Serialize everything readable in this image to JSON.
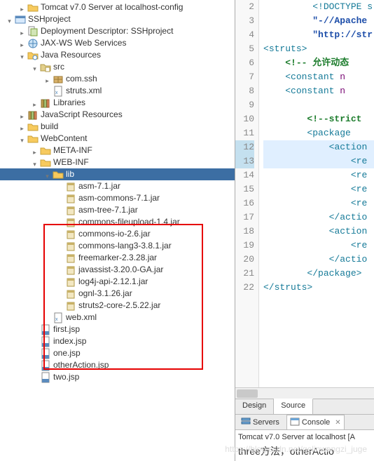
{
  "tree": [
    {
      "indent": 1,
      "arrow": "right",
      "icon": "folder",
      "label": "Tomcat v7.0 Server at localhost-config"
    },
    {
      "indent": 0,
      "arrow": "down",
      "icon": "project",
      "label": "SSHproject"
    },
    {
      "indent": 1,
      "arrow": "right",
      "icon": "dd",
      "label": "Deployment Descriptor: SSHproject"
    },
    {
      "indent": 1,
      "arrow": "right",
      "icon": "jaxws",
      "label": "JAX-WS Web Services"
    },
    {
      "indent": 1,
      "arrow": "down",
      "icon": "java",
      "label": "Java Resources"
    },
    {
      "indent": 2,
      "arrow": "down",
      "icon": "srcfolder",
      "label": "src"
    },
    {
      "indent": 3,
      "arrow": "right",
      "icon": "pkg",
      "label": "com.ssh"
    },
    {
      "indent": 3,
      "arrow": "",
      "icon": "xml",
      "label": "struts.xml"
    },
    {
      "indent": 2,
      "arrow": "right",
      "icon": "lib",
      "label": "Libraries"
    },
    {
      "indent": 1,
      "arrow": "right",
      "icon": "lib",
      "label": "JavaScript Resources"
    },
    {
      "indent": 1,
      "arrow": "right",
      "icon": "folder",
      "label": "build"
    },
    {
      "indent": 1,
      "arrow": "down",
      "icon": "folder",
      "label": "WebContent"
    },
    {
      "indent": 2,
      "arrow": "right",
      "icon": "folder",
      "label": "META-INF"
    },
    {
      "indent": 2,
      "arrow": "down",
      "icon": "folder",
      "label": "WEB-INF"
    },
    {
      "indent": 3,
      "arrow": "down",
      "icon": "folder",
      "label": "lib",
      "selected": true
    },
    {
      "indent": 4,
      "arrow": "",
      "icon": "jar",
      "label": "asm-7.1.jar"
    },
    {
      "indent": 4,
      "arrow": "",
      "icon": "jar",
      "label": "asm-commons-7.1.jar"
    },
    {
      "indent": 4,
      "arrow": "",
      "icon": "jar",
      "label": "asm-tree-7.1.jar"
    },
    {
      "indent": 4,
      "arrow": "",
      "icon": "jar",
      "label": "commons-fileupload-1.4.jar"
    },
    {
      "indent": 4,
      "arrow": "",
      "icon": "jar",
      "label": "commons-io-2.6.jar"
    },
    {
      "indent": 4,
      "arrow": "",
      "icon": "jar",
      "label": "commons-lang3-3.8.1.jar"
    },
    {
      "indent": 4,
      "arrow": "",
      "icon": "jar",
      "label": "freemarker-2.3.28.jar"
    },
    {
      "indent": 4,
      "arrow": "",
      "icon": "jar",
      "label": "javassist-3.20.0-GA.jar"
    },
    {
      "indent": 4,
      "arrow": "",
      "icon": "jar",
      "label": "log4j-api-2.12.1.jar"
    },
    {
      "indent": 4,
      "arrow": "",
      "icon": "jar",
      "label": "ognl-3.1.26.jar"
    },
    {
      "indent": 4,
      "arrow": "",
      "icon": "jar",
      "label": "struts2-core-2.5.22.jar"
    },
    {
      "indent": 3,
      "arrow": "",
      "icon": "xml",
      "label": "web.xml"
    },
    {
      "indent": 2,
      "arrow": "",
      "icon": "jsp",
      "label": "first.jsp"
    },
    {
      "indent": 2,
      "arrow": "",
      "icon": "jsp",
      "label": "index.jsp"
    },
    {
      "indent": 2,
      "arrow": "",
      "icon": "jsp",
      "label": "one.jsp"
    },
    {
      "indent": 2,
      "arrow": "",
      "icon": "jsp",
      "label": "otherAction.jsp"
    },
    {
      "indent": 2,
      "arrow": "",
      "icon": "jsp",
      "label": "two.jsp"
    }
  ],
  "code": {
    "lines": [
      {
        "n": 2,
        "tokens": [
          {
            "t": "         ",
            "c": ""
          },
          {
            "t": "<!DOCTYPE s",
            "c": "tok-tag"
          }
        ]
      },
      {
        "n": 3,
        "tokens": [
          {
            "t": "         ",
            "c": ""
          },
          {
            "t": "\"-//Apache",
            "c": "tok-str"
          }
        ]
      },
      {
        "n": 4,
        "tokens": [
          {
            "t": "         ",
            "c": ""
          },
          {
            "t": "\"http://str",
            "c": "tok-str"
          }
        ]
      },
      {
        "n": 5,
        "tokens": [
          {
            "t": "<",
            "c": "tok-punct"
          },
          {
            "t": "struts",
            "c": "tok-tag"
          },
          {
            "t": ">",
            "c": "tok-punct"
          }
        ]
      },
      {
        "n": 6,
        "tokens": [
          {
            "t": "    ",
            "c": ""
          },
          {
            "t": "<!-- 允许动态",
            "c": "tok-comment"
          }
        ]
      },
      {
        "n": 7,
        "tokens": [
          {
            "t": "    ",
            "c": ""
          },
          {
            "t": "<",
            "c": "tok-punct"
          },
          {
            "t": "constant",
            "c": "tok-tag"
          },
          {
            "t": " ",
            "c": ""
          },
          {
            "t": "n",
            "c": "tok-attr"
          }
        ]
      },
      {
        "n": 8,
        "tokens": [
          {
            "t": "    ",
            "c": ""
          },
          {
            "t": "<",
            "c": "tok-punct"
          },
          {
            "t": "constant",
            "c": "tok-tag"
          },
          {
            "t": " ",
            "c": ""
          },
          {
            "t": "n",
            "c": "tok-attr"
          }
        ]
      },
      {
        "n": 9,
        "tokens": [
          {
            "t": "",
            "c": ""
          }
        ]
      },
      {
        "n": 10,
        "tokens": [
          {
            "t": "        ",
            "c": ""
          },
          {
            "t": "<!--strict",
            "c": "tok-comment"
          }
        ]
      },
      {
        "n": 11,
        "tokens": [
          {
            "t": "        ",
            "c": ""
          },
          {
            "t": "<",
            "c": "tok-punct"
          },
          {
            "t": "package",
            "c": "tok-tag"
          }
        ]
      },
      {
        "n": 12,
        "hl": true,
        "tokens": [
          {
            "t": "            ",
            "c": ""
          },
          {
            "t": "<",
            "c": "tok-punct"
          },
          {
            "t": "action",
            "c": "tok-tag"
          }
        ]
      },
      {
        "n": 13,
        "hl": true,
        "tokens": [
          {
            "t": "                ",
            "c": ""
          },
          {
            "t": "<",
            "c": "tok-punct"
          },
          {
            "t": "re",
            "c": "tok-tag"
          }
        ]
      },
      {
        "n": 14,
        "tokens": [
          {
            "t": "                ",
            "c": ""
          },
          {
            "t": "<",
            "c": "tok-punct"
          },
          {
            "t": "re",
            "c": "tok-tag"
          }
        ]
      },
      {
        "n": 15,
        "tokens": [
          {
            "t": "                ",
            "c": ""
          },
          {
            "t": "<",
            "c": "tok-punct"
          },
          {
            "t": "re",
            "c": "tok-tag"
          }
        ]
      },
      {
        "n": 16,
        "tokens": [
          {
            "t": "                ",
            "c": ""
          },
          {
            "t": "<",
            "c": "tok-punct"
          },
          {
            "t": "re",
            "c": "tok-tag"
          }
        ]
      },
      {
        "n": 17,
        "tokens": [
          {
            "t": "            ",
            "c": ""
          },
          {
            "t": "</",
            "c": "tok-punct"
          },
          {
            "t": "actio",
            "c": "tok-tag"
          }
        ]
      },
      {
        "n": 18,
        "tokens": [
          {
            "t": "            ",
            "c": ""
          },
          {
            "t": "<",
            "c": "tok-punct"
          },
          {
            "t": "action",
            "c": "tok-tag"
          }
        ]
      },
      {
        "n": 19,
        "tokens": [
          {
            "t": "                ",
            "c": ""
          },
          {
            "t": "<",
            "c": "tok-punct"
          },
          {
            "t": "re",
            "c": "tok-tag"
          }
        ]
      },
      {
        "n": 20,
        "tokens": [
          {
            "t": "            ",
            "c": ""
          },
          {
            "t": "</",
            "c": "tok-punct"
          },
          {
            "t": "actio",
            "c": "tok-tag"
          }
        ]
      },
      {
        "n": 21,
        "tokens": [
          {
            "t": "        ",
            "c": ""
          },
          {
            "t": "</",
            "c": "tok-punct"
          },
          {
            "t": "package",
            "c": "tok-tag"
          },
          {
            "t": ">",
            "c": "tok-punct"
          }
        ]
      },
      {
        "n": 22,
        "tokens": [
          {
            "t": "</",
            "c": "tok-punct"
          },
          {
            "t": "struts",
            "c": "tok-tag"
          },
          {
            "t": ">",
            "c": "tok-punct"
          }
        ]
      }
    ]
  },
  "tabs": {
    "design": "Design",
    "source": "Source"
  },
  "views": {
    "servers": "Servers",
    "console": "Console"
  },
  "console": {
    "server_status": "Tomcat v7.0 Server at localhost [A",
    "output": "three方法，otherActio"
  },
  "watermark": "https://blog.csdn.net/gelinwangzi_juge"
}
